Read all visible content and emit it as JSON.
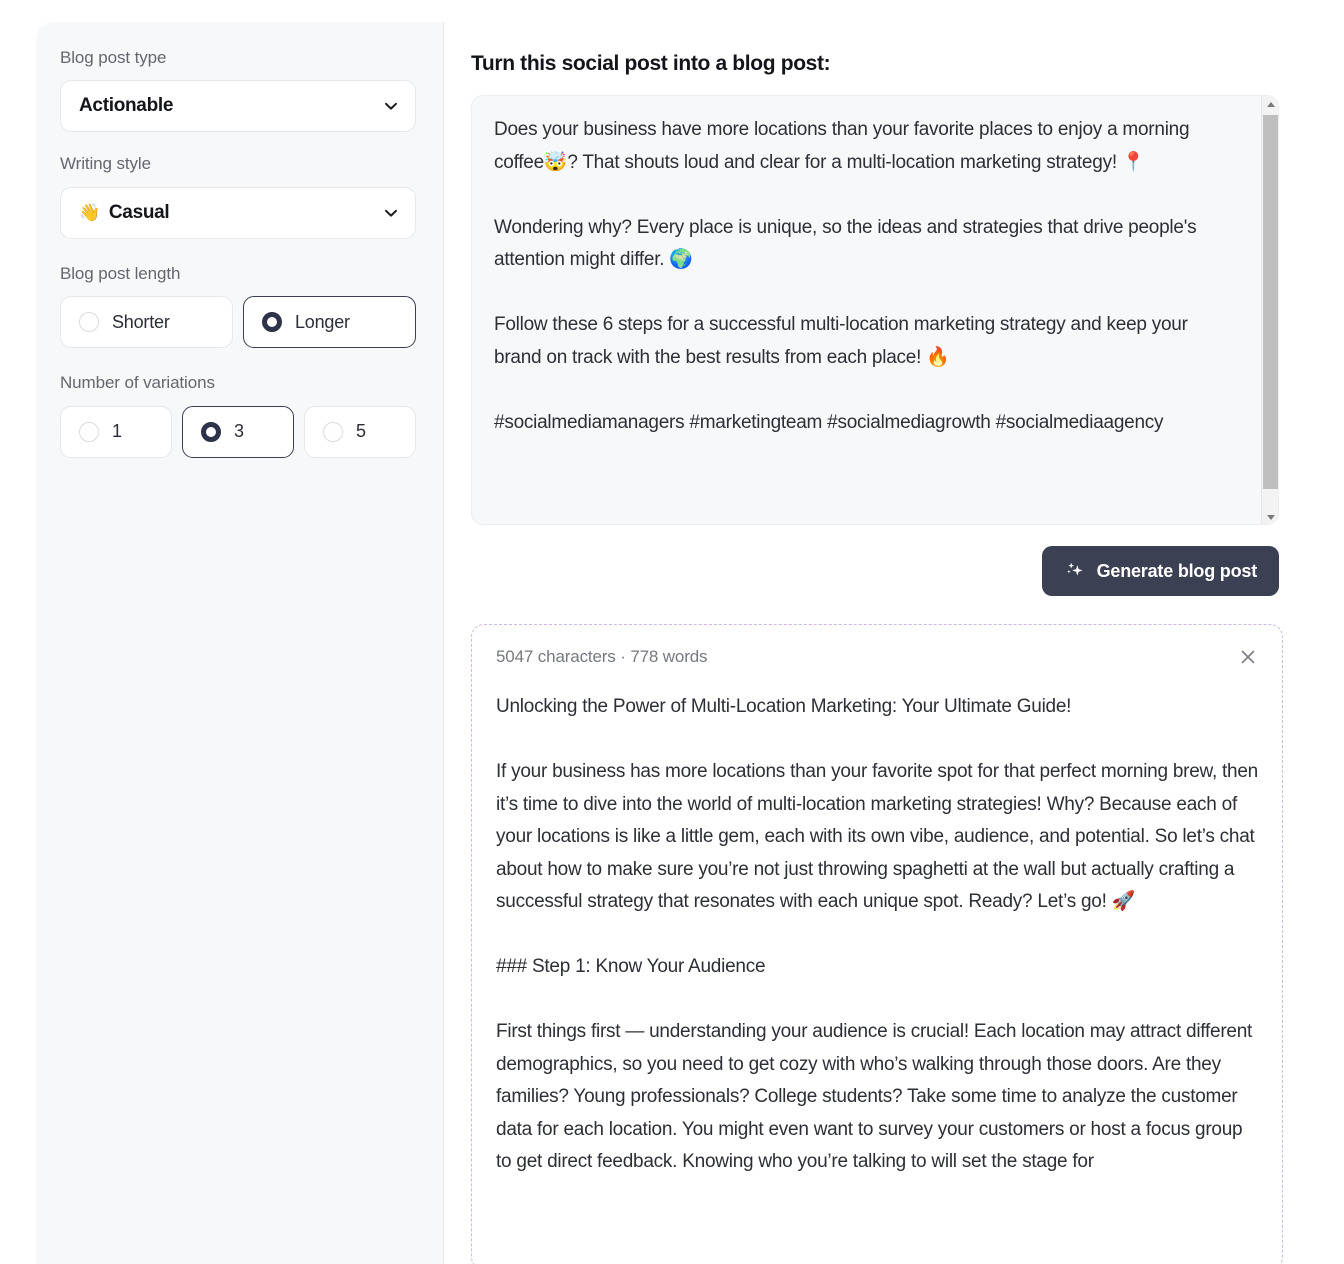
{
  "sidebar": {
    "blog_post_type": {
      "label": "Blog post type",
      "value": "Actionable",
      "chevron_icon": "chevron-down-icon"
    },
    "writing_style": {
      "label": "Writing style",
      "emoji": "👋",
      "value": "Casual",
      "chevron_icon": "chevron-down-icon"
    },
    "blog_post_length": {
      "label": "Blog post length",
      "options": [
        {
          "label": "Shorter",
          "selected": false
        },
        {
          "label": "Longer",
          "selected": true
        }
      ]
    },
    "number_of_variations": {
      "label": "Number of variations",
      "options": [
        {
          "label": "1",
          "selected": false
        },
        {
          "label": "3",
          "selected": true
        },
        {
          "label": "5",
          "selected": false
        }
      ]
    }
  },
  "main": {
    "title": "Turn this social post into a blog post:",
    "source_post": "Does your business have more locations than your favorite places to enjoy a morning coffee🤯? That shouts loud and clear for a multi-location marketing strategy! 📍\n\nWondering why? Every place is unique, so the ideas and strategies that drive people's attention might differ. 🌍\n\nFollow these 6 steps for a successful multi-location marketing strategy and keep your brand on track with the best results from each place! 🔥\n\n#socialmediamanagers #marketingteam #socialmediagrowth #socialmediaagency",
    "generate_button": {
      "label": "Generate blog post",
      "icon": "sparkles-icon"
    },
    "result": {
      "meta": "5047 characters · 778 words",
      "close_icon": "close-icon",
      "body": "Unlocking the Power of Multi-Location Marketing: Your Ultimate Guide!\n\nIf your business has more locations than your favorite spot for that perfect morning brew, then it’s time to dive into the world of multi-location marketing strategies! Why? Because each of your locations is like a little gem, each with its own vibe, audience, and potential. So let’s chat about how to make sure you’re not just throwing spaghetti at the wall but actually crafting a successful strategy that resonates with each unique spot. Ready? Let’s go! 🚀\n\n### Step 1: Know Your Audience\n\nFirst things first — understanding your audience is crucial! Each location may attract different demographics, so you need to get cozy with who’s walking through those doors. Are they families? Young professionals? College students? Take some time to analyze the customer data for each location. You might even want to survey your customers or host a focus group to get direct feedback. Knowing who you’re talking to will set the stage for"
    }
  },
  "colors": {
    "accent_dark": "#3b4052",
    "panel_bg": "#f7f8f9",
    "dashed_border": "#cdb7e3",
    "muted_text": "#75787f"
  }
}
